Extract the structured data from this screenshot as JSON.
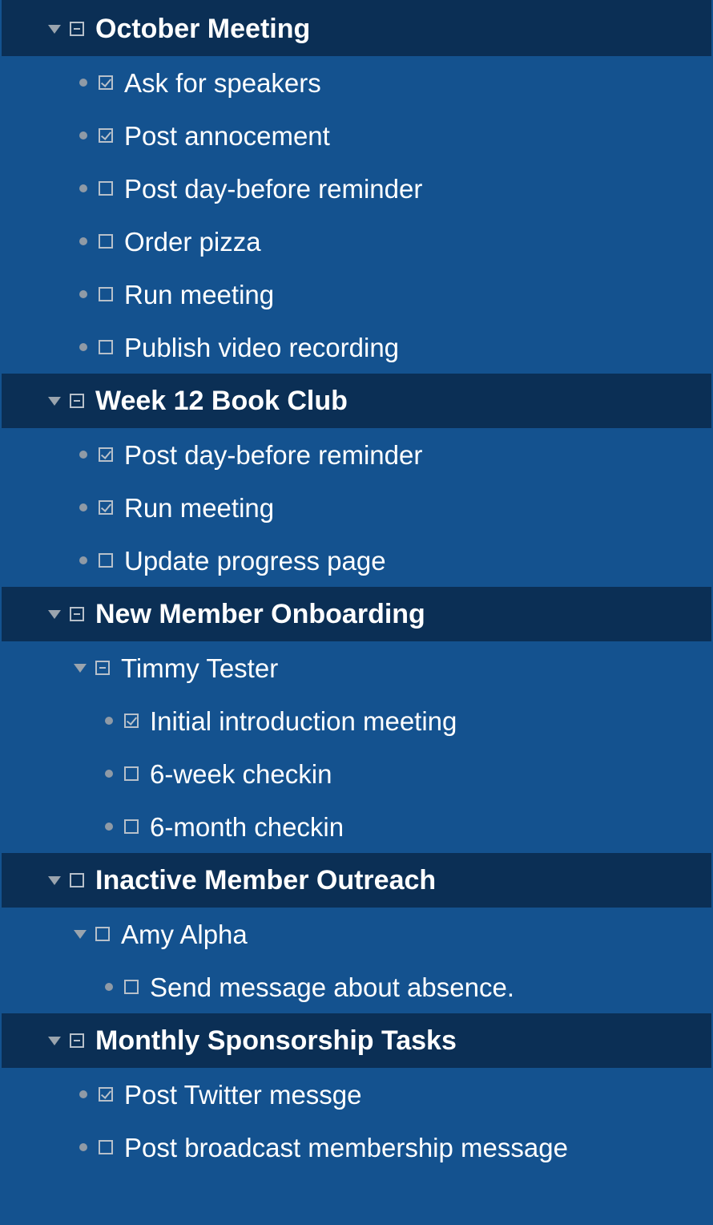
{
  "groups": [
    {
      "title": "October Meeting",
      "state": "mixed",
      "items": [
        {
          "label": "Ask for speakers",
          "checked": true
        },
        {
          "label": "Post annocement",
          "checked": true
        },
        {
          "label": "Post day-before reminder",
          "checked": false
        },
        {
          "label": "Order pizza",
          "checked": false
        },
        {
          "label": "Run meeting",
          "checked": false
        },
        {
          "label": "Publish video recording",
          "checked": false
        }
      ]
    },
    {
      "title": "Week 12 Book Club",
      "state": "mixed",
      "items": [
        {
          "label": "Post day-before reminder",
          "checked": true
        },
        {
          "label": "Run meeting",
          "checked": true
        },
        {
          "label": "Update progress page",
          "checked": false
        }
      ]
    },
    {
      "title": "New Member Onboarding",
      "state": "mixed",
      "subgroup": {
        "title": "Timmy Tester",
        "state": "mixed",
        "items": [
          {
            "label": "Initial introduction meeting",
            "checked": true
          },
          {
            "label": "6-week checkin",
            "checked": false
          },
          {
            "label": "6-month checkin",
            "checked": false
          }
        ]
      }
    },
    {
      "title": "Inactive Member Outreach",
      "state": "unchecked",
      "subgroup": {
        "title": "Amy Alpha",
        "state": "unchecked",
        "items": [
          {
            "label": "Send message about absence.",
            "checked": false
          }
        ]
      }
    },
    {
      "title": "Monthly Sponsorship Tasks",
      "state": "mixed",
      "items": [
        {
          "label": "Post Twitter messge",
          "checked": true
        },
        {
          "label": "Post broadcast membership message",
          "checked": false
        }
      ]
    }
  ]
}
